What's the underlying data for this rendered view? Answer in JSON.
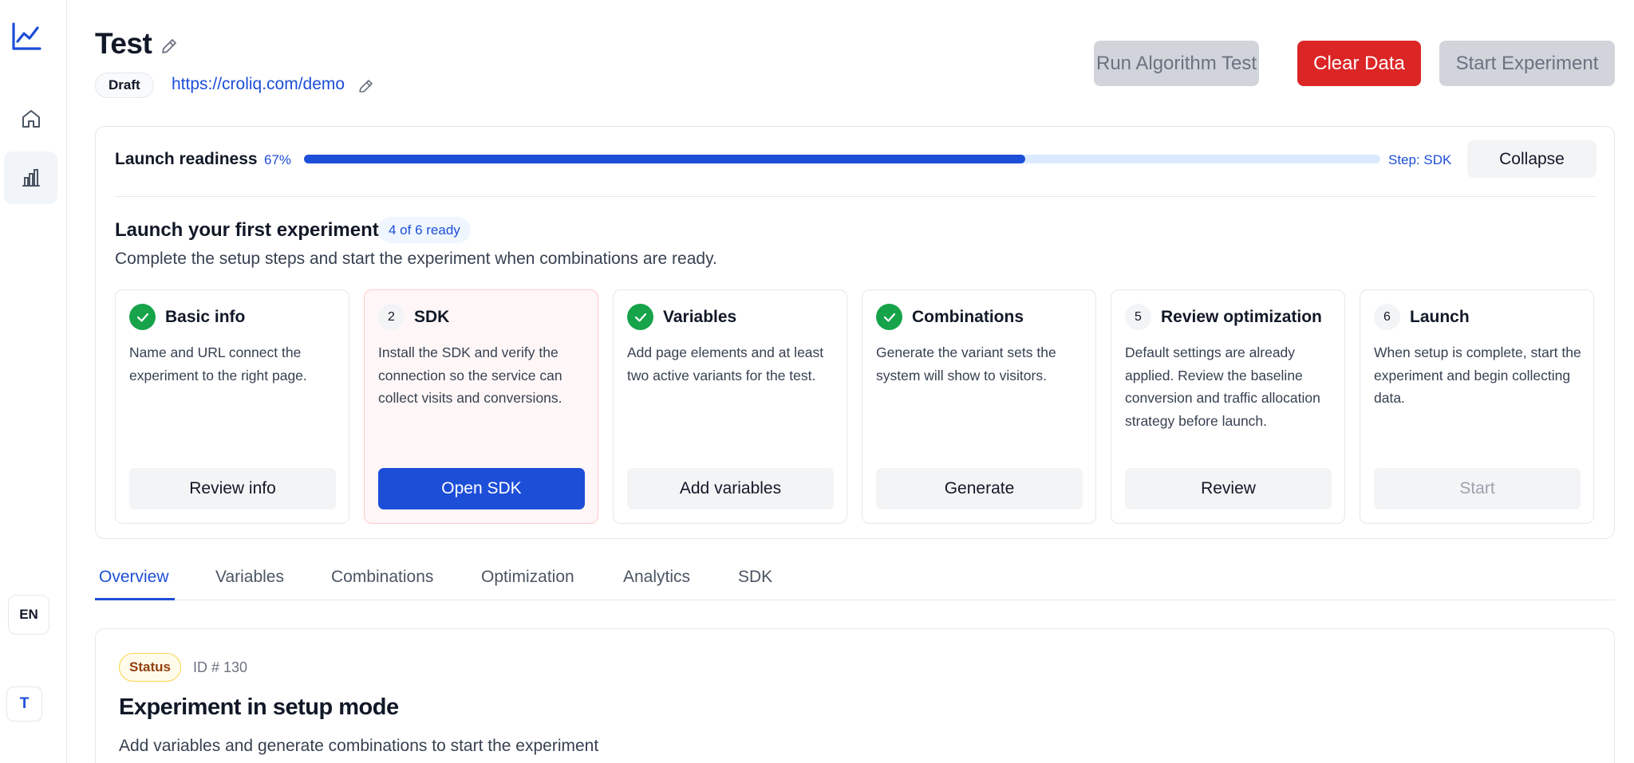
{
  "sidebar": {
    "lang": "EN",
    "avatar_initial": "T"
  },
  "header": {
    "title": "Test",
    "status": "Draft",
    "url": "https://croliq.com/demo",
    "buttons": {
      "run_algorithm": "Run Algorithm Test",
      "clear_data": "Clear Data",
      "start_experiment": "Start Experiment"
    }
  },
  "readiness": {
    "label": "Launch readiness",
    "percent_text": "67%",
    "percent_value": 67,
    "step_text": "Step: SDK",
    "collapse": "Collapse",
    "heading": "Launch your first experiment",
    "ready_badge": "4 of 6 ready",
    "subtitle": "Complete the setup steps and start the experiment when combinations are ready.",
    "steps": [
      {
        "num": "1",
        "done": true,
        "name": "Basic info",
        "desc": "Name and URL connect the experiment to the right page.",
        "action": "Review info"
      },
      {
        "num": "2",
        "done": false,
        "name": "SDK",
        "desc": "Install the SDK and verify the connection so the service can collect visits and conversions.",
        "action": "Open SDK"
      },
      {
        "num": "3",
        "done": true,
        "name": "Variables",
        "desc": "Add page elements and at least two active variants for the test.",
        "action": "Add variables"
      },
      {
        "num": "4",
        "done": true,
        "name": "Combinations",
        "desc": "Generate the variant sets the system will show to visitors.",
        "action": "Generate"
      },
      {
        "num": "5",
        "done": false,
        "name": "Review optimization",
        "desc": "Default settings are already applied. Review the baseline conversion and traffic allocation strategy before launch.",
        "action": "Review"
      },
      {
        "num": "6",
        "done": false,
        "name": "Launch",
        "desc": "When setup is complete, start the experiment and begin collecting data.",
        "action": "Start"
      }
    ]
  },
  "tabs": [
    "Overview",
    "Variables",
    "Combinations",
    "Optimization",
    "Analytics",
    "SDK"
  ],
  "overview": {
    "status_badge": "Status",
    "id_text": "ID # 130",
    "title": "Experiment in setup mode",
    "subtitle": "Add variables and generate combinations to start the experiment"
  },
  "colors": {
    "accent": "#1d4ed8",
    "danger": "#dc2626",
    "success": "#16a34a"
  }
}
